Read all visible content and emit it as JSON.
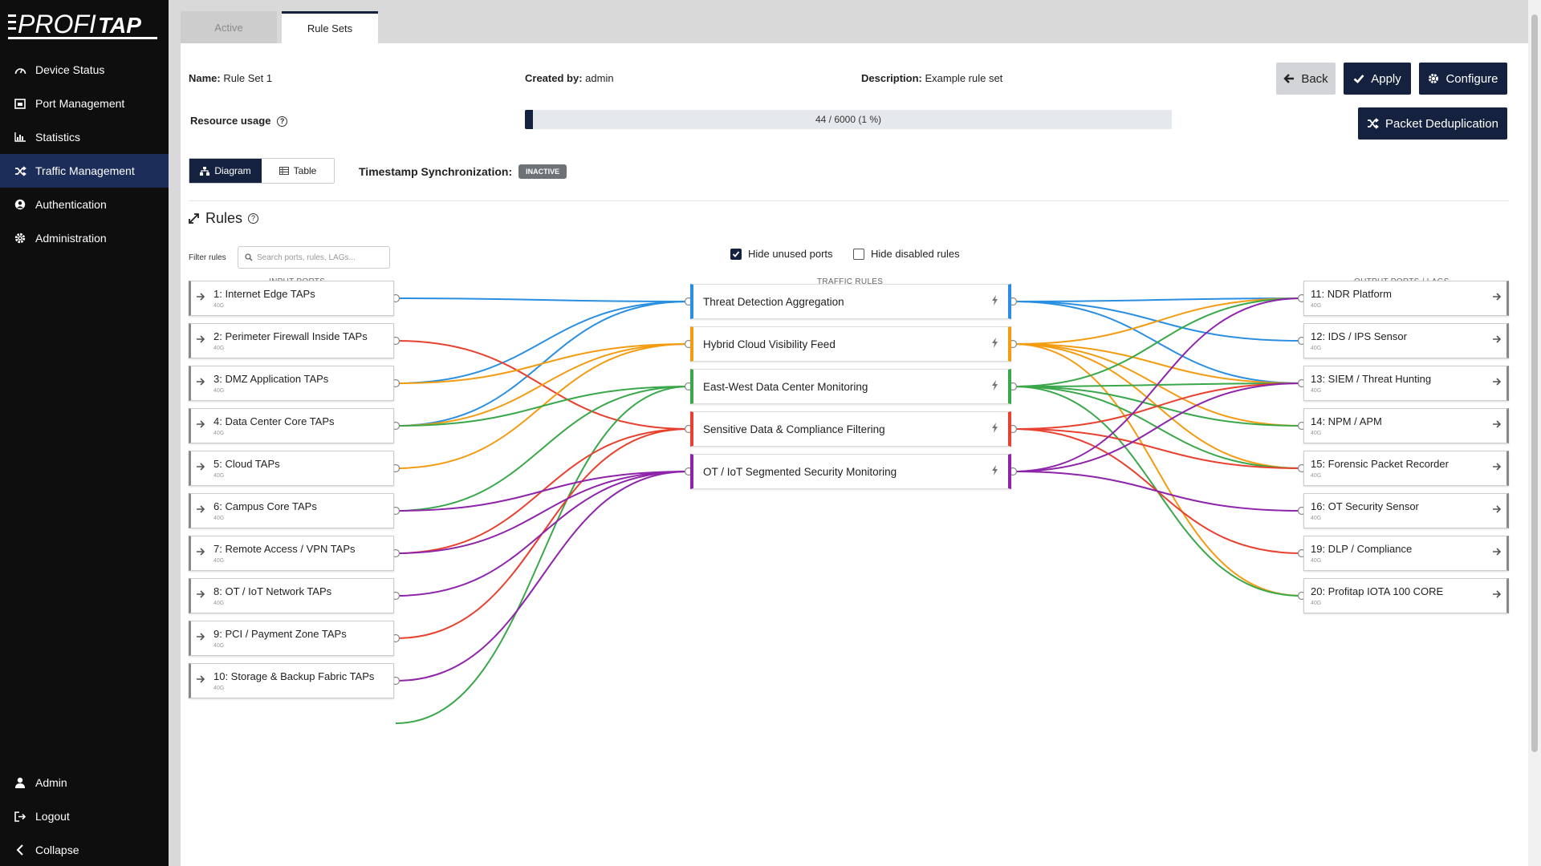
{
  "brand": {
    "logo_left": "PROFI",
    "logo_right": "TAP"
  },
  "sidebar": {
    "items": [
      {
        "label": "Device Status",
        "icon": "gauge-icon",
        "active": false
      },
      {
        "label": "Port Management",
        "icon": "port-icon",
        "active": false
      },
      {
        "label": "Statistics",
        "icon": "bar-chart-icon",
        "active": false
      },
      {
        "label": "Traffic Management",
        "icon": "shuffle-icon",
        "active": true
      },
      {
        "label": "Authentication",
        "icon": "user-circle-icon",
        "active": false
      },
      {
        "label": "Administration",
        "icon": "gear-icon",
        "active": false
      }
    ],
    "bottom": [
      {
        "label": "Admin",
        "icon": "user-icon"
      },
      {
        "label": "Logout",
        "icon": "logout-icon"
      },
      {
        "label": "Collapse",
        "icon": "chevron-left-icon"
      }
    ]
  },
  "tabs": [
    {
      "label": "Active",
      "active": false
    },
    {
      "label": "Rule Sets",
      "active": true
    }
  ],
  "ruleset": {
    "name_label": "Name:",
    "name": "Rule Set 1",
    "created_label": "Created by:",
    "created_by": "admin",
    "desc_label": "Description:",
    "description": "Example rule set"
  },
  "buttons": {
    "back": "Back",
    "apply": "Apply",
    "configure": "Configure",
    "dedup": "Packet Deduplication"
  },
  "resource": {
    "label": "Resource usage",
    "text": "44 / 6000 (1 %)",
    "used": 44,
    "total": 6000
  },
  "view": {
    "diagram": "Diagram",
    "table": "Table"
  },
  "timestamp": {
    "label": "Timestamp Synchronization:",
    "status": "INACTIVE"
  },
  "rules_section": {
    "title": "Rules",
    "filter_label": "Filter rules",
    "filter_placeholder": "Search ports, rules, LAGs...",
    "hide_unused": "Hide unused ports",
    "hide_unused_checked": true,
    "hide_disabled": "Hide disabled rules",
    "hide_disabled_checked": false
  },
  "columns": {
    "input": "INPUT PORTS",
    "rules": "TRAFFIC RULES",
    "output": "OUTPUT PORTS / LAGS"
  },
  "input_ports": [
    {
      "name": "1: Internet Edge TAPs",
      "speed": "40G"
    },
    {
      "name": "2: Perimeter Firewall Inside TAPs",
      "speed": "40G"
    },
    {
      "name": "3: DMZ Application TAPs",
      "speed": "40G"
    },
    {
      "name": "4: Data Center Core TAPs",
      "speed": "40G"
    },
    {
      "name": "5: Cloud TAPs",
      "speed": "40G"
    },
    {
      "name": "6: Campus Core TAPs",
      "speed": "40G"
    },
    {
      "name": "7: Remote Access / VPN TAPs",
      "speed": "40G"
    },
    {
      "name": "8: OT / IoT Network TAPs",
      "speed": "40G"
    },
    {
      "name": "9: PCI / Payment Zone TAPs",
      "speed": "40G"
    },
    {
      "name": "10: Storage & Backup Fabric TAPs",
      "speed": "40G"
    }
  ],
  "traffic_rules": [
    {
      "name": "Threat Detection Aggregation",
      "color": "#2a8fe0"
    },
    {
      "name": "Hybrid Cloud Visibility Feed",
      "color": "#f39c12"
    },
    {
      "name": "East-West Data Center Monitoring",
      "color": "#3aa84a"
    },
    {
      "name": "Sensitive Data & Compliance Filtering",
      "color": "#e8412f"
    },
    {
      "name": "OT / IoT Segmented Security Monitoring",
      "color": "#8e24aa"
    }
  ],
  "output_ports": [
    {
      "name": "11: NDR Platform",
      "speed": "40G"
    },
    {
      "name": "12: IDS / IPS Sensor",
      "speed": "40G"
    },
    {
      "name": "13: SIEM / Threat Hunting",
      "speed": "40G"
    },
    {
      "name": "14: NPM / APM",
      "speed": "40G"
    },
    {
      "name": "15: Forensic Packet Recorder",
      "speed": "40G"
    },
    {
      "name": "16: OT Security Sensor",
      "speed": "40G"
    },
    {
      "name": "19: DLP / Compliance",
      "speed": "40G"
    },
    {
      "name": "20: Profitap IOTA 100 CORE",
      "speed": "40G"
    }
  ],
  "input_links": [
    [
      0,
      0
    ],
    [
      2,
      0
    ],
    [
      3,
      0
    ],
    [
      1,
      3
    ],
    [
      2,
      1
    ],
    [
      3,
      1
    ],
    [
      4,
      1
    ],
    [
      3,
      2
    ],
    [
      5,
      2
    ],
    [
      10,
      2
    ],
    [
      6,
      3
    ],
    [
      8,
      3
    ],
    [
      5,
      4
    ],
    [
      6,
      4
    ],
    [
      7,
      4
    ],
    [
      9,
      4
    ]
  ],
  "output_links": [
    [
      0,
      0
    ],
    [
      0,
      1
    ],
    [
      0,
      2
    ],
    [
      1,
      0
    ],
    [
      1,
      2
    ],
    [
      1,
      3
    ],
    [
      1,
      4
    ],
    [
      1,
      7
    ],
    [
      2,
      0
    ],
    [
      2,
      2
    ],
    [
      2,
      3
    ],
    [
      2,
      4
    ],
    [
      2,
      7
    ],
    [
      3,
      2
    ],
    [
      3,
      4
    ],
    [
      3,
      6
    ],
    [
      4,
      0
    ],
    [
      4,
      2
    ],
    [
      4,
      5
    ]
  ]
}
